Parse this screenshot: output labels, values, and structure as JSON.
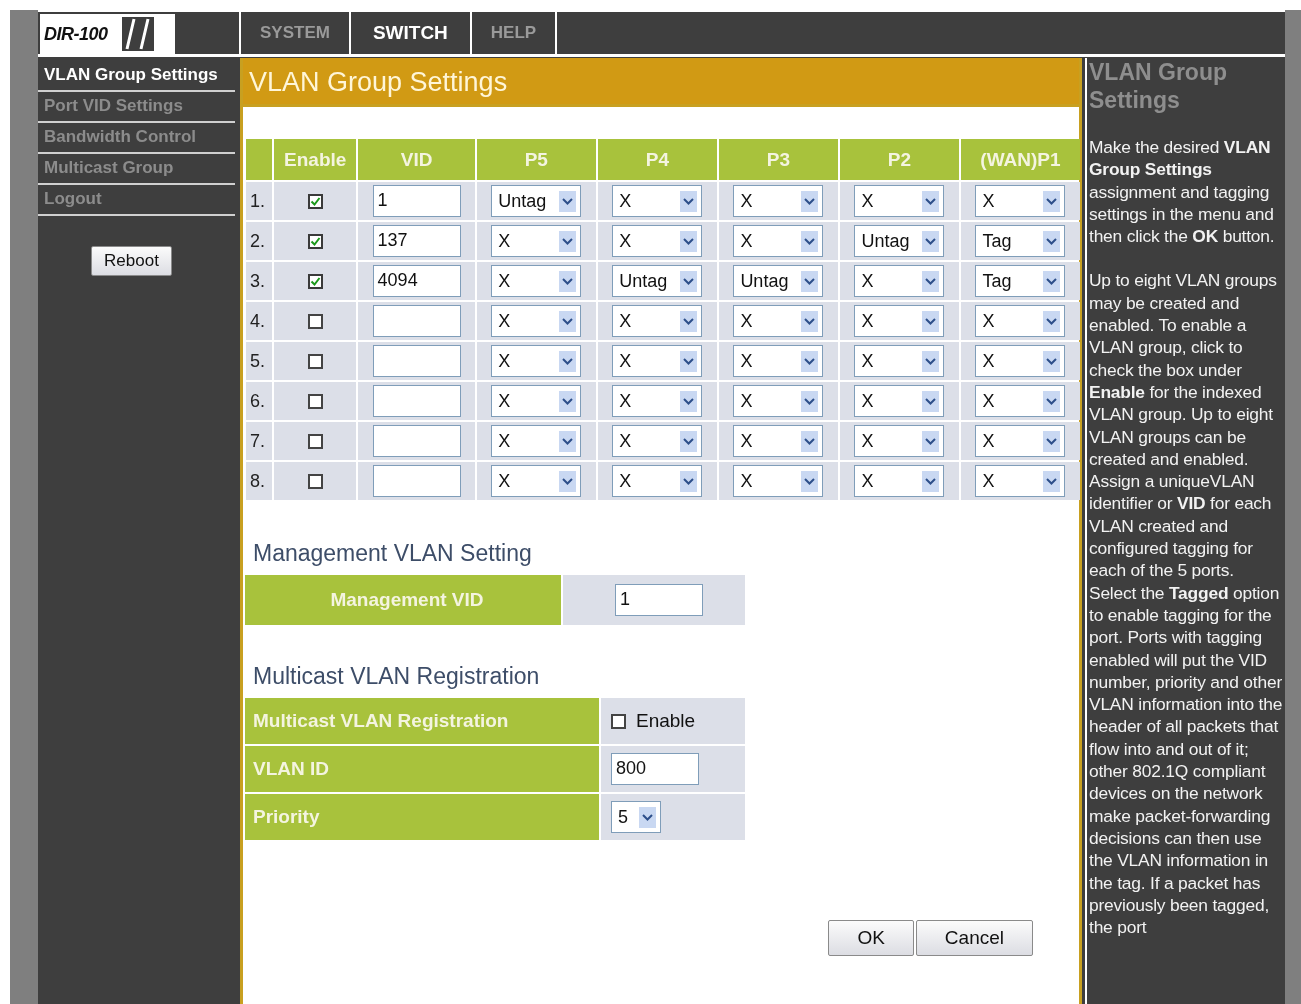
{
  "logo": {
    "text": "DIR-100"
  },
  "tabs": [
    {
      "label": "SYSTEM",
      "selected": false
    },
    {
      "label": "SWITCH",
      "selected": true
    },
    {
      "label": "HELP",
      "selected": false
    }
  ],
  "sidebar": {
    "items": [
      {
        "label": "VLAN Group Settings",
        "selected": true
      },
      {
        "label": "Port VID Settings",
        "selected": false
      },
      {
        "label": "Bandwidth Control",
        "selected": false
      },
      {
        "label": "Multicast Group",
        "selected": false
      },
      {
        "label": "Logout",
        "selected": false
      }
    ],
    "reboot_button": "Reboot"
  },
  "page_title": "VLAN Group Settings",
  "vlan_table": {
    "columns": [
      "Enable",
      "VID",
      "P5",
      "P4",
      "P3",
      "P2",
      "(WAN)P1"
    ],
    "rows": [
      {
        "index": "1.",
        "enabled": true,
        "vid": "1",
        "ports": [
          "Untag",
          "X",
          "X",
          "X",
          "X"
        ]
      },
      {
        "index": "2.",
        "enabled": true,
        "vid": "137",
        "ports": [
          "X",
          "X",
          "X",
          "Untag",
          "Tag"
        ]
      },
      {
        "index": "3.",
        "enabled": true,
        "vid": "4094",
        "ports": [
          "X",
          "Untag",
          "Untag",
          "X",
          "Tag"
        ]
      },
      {
        "index": "4.",
        "enabled": false,
        "ports": [
          "X",
          "X",
          "X",
          "X",
          "X"
        ]
      },
      {
        "index": "5.",
        "enabled": false,
        "ports": [
          "X",
          "X",
          "X",
          "X",
          "X"
        ]
      },
      {
        "index": "6.",
        "enabled": false,
        "ports": [
          "X",
          "X",
          "X",
          "X",
          "X"
        ]
      },
      {
        "index": "7.",
        "enabled": false,
        "ports": [
          "X",
          "X",
          "X",
          "X",
          "X"
        ]
      },
      {
        "index": "8.",
        "enabled": false,
        "ports": [
          "X",
          "X",
          "X",
          "X",
          "X"
        ]
      }
    ]
  },
  "management": {
    "heading": "Management VLAN Setting",
    "label": "Management VID",
    "value": "1"
  },
  "multicast": {
    "heading": "Multicast VLAN Registration",
    "rows": [
      {
        "kind": "checkbox",
        "label": "Multicast VLAN Registration",
        "checked": false,
        "option": "Enable"
      },
      {
        "kind": "input",
        "label": "VLAN ID",
        "value": "800"
      },
      {
        "kind": "select",
        "label": "Priority",
        "value": "5"
      }
    ]
  },
  "buttons": [
    "OK",
    "Cancel"
  ],
  "help": {
    "title": "VLAN Group Settings",
    "paragraphs": [
      "Make the desired **VLAN Group Settings** assignment and tagging settings in the menu and then click the **OK** button.",
      "Up to eight VLAN groups may be created and enabled. To enable a VLAN group, click to check the box under **Enable** for the indexed VLAN group. Up to eight VLAN groups can be created and enabled. Assign a uniqueVLAN identifier or **VID** for each VLAN created and configured tagging for each of the 5 ports. Select the **Tagged** option to enable tagging for the port. Ports with tagging enabled will put the VID number, priority and other VLAN information into the header of all packets that flow into and out of it; other 802.1Q compliant devices on the network make packet-forwarding decisions can then use the VLAN information in the tag. If a packet has previously been tagged, the port"
    ]
  }
}
